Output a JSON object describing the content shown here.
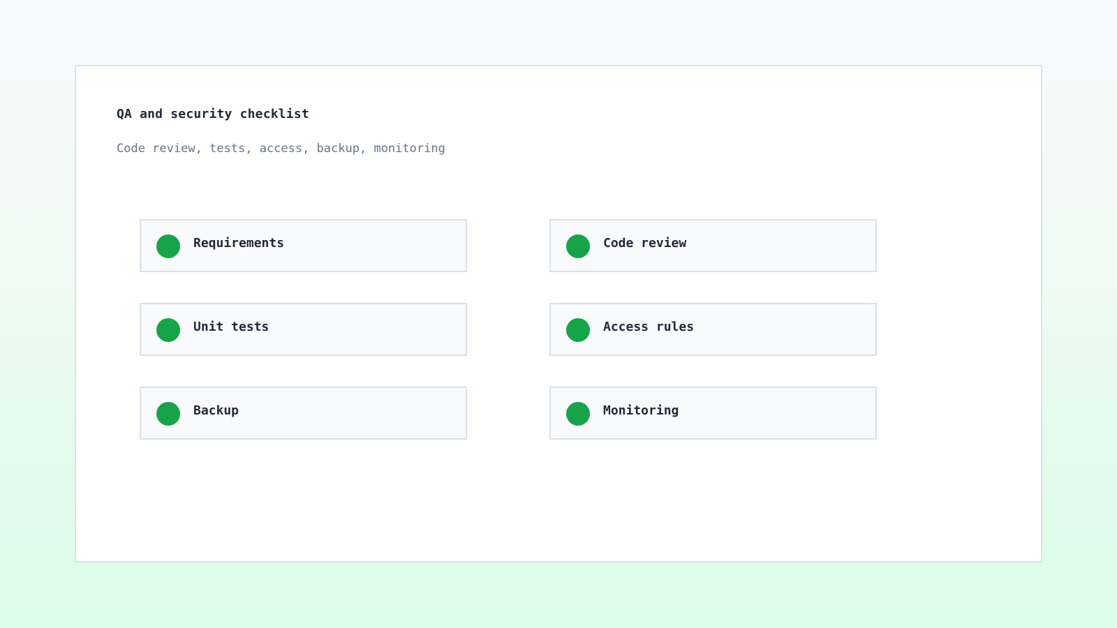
{
  "checklist": {
    "title": "QA and security checklist",
    "subtitle": "Code review, tests, access, backup, monitoring",
    "status_color": "#16a34a",
    "items": [
      {
        "label": "Requirements",
        "status": "done",
        "icon": "status-dot-icon"
      },
      {
        "label": "Code review",
        "status": "done",
        "icon": "status-dot-icon"
      },
      {
        "label": "Unit tests",
        "status": "done",
        "icon": "status-dot-icon"
      },
      {
        "label": "Access rules",
        "status": "done",
        "icon": "status-dot-icon"
      },
      {
        "label": "Backup",
        "status": "done",
        "icon": "status-dot-icon"
      },
      {
        "label": "Monitoring",
        "status": "done",
        "icon": "status-dot-icon"
      }
    ]
  }
}
